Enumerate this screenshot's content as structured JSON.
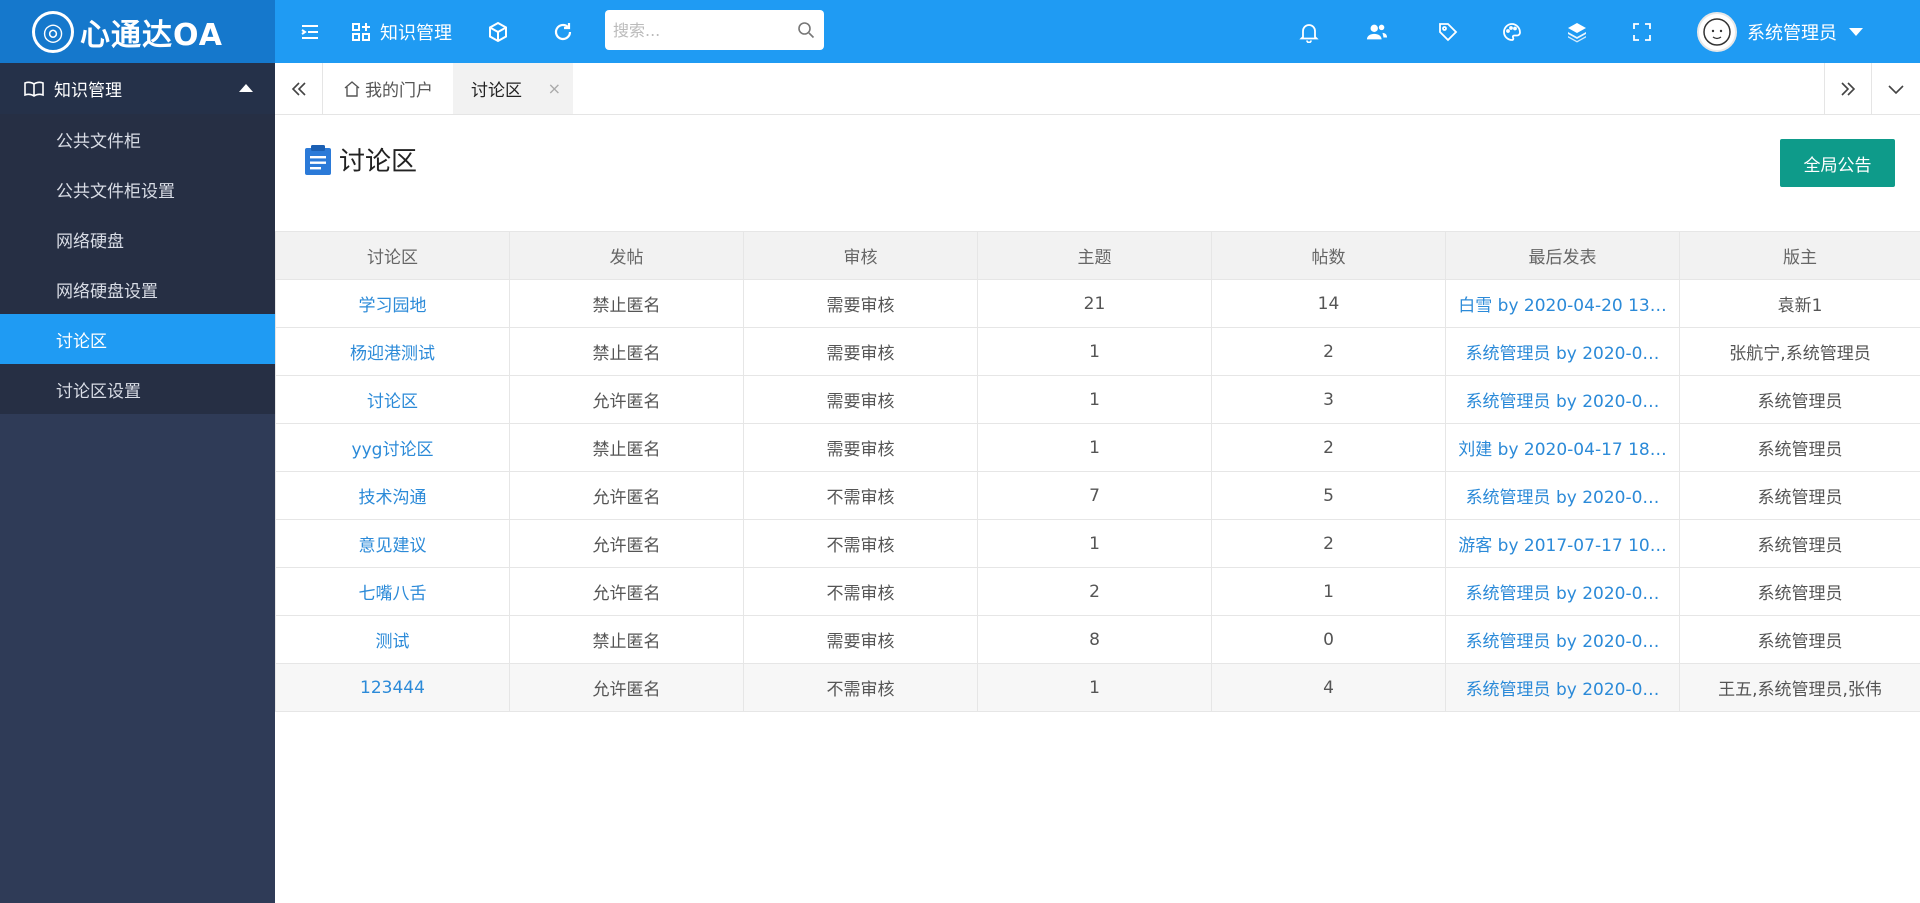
{
  "app": {
    "logo_text": "心通达OA"
  },
  "topbar": {
    "module_label": "知识管理",
    "search_placeholder": "搜索...",
    "user_name": "系统管理员"
  },
  "sidebar": {
    "section_label": "知识管理",
    "items": [
      {
        "label": "公共文件柜",
        "active": false
      },
      {
        "label": "公共文件柜设置",
        "active": false
      },
      {
        "label": "网络硬盘",
        "active": false
      },
      {
        "label": "网络硬盘设置",
        "active": false
      },
      {
        "label": "讨论区",
        "active": true
      },
      {
        "label": "讨论区设置",
        "active": false
      }
    ]
  },
  "tabs": {
    "home_label": "我的门户",
    "active_label": "讨论区",
    "close_glyph": "×"
  },
  "main": {
    "title": "讨论区",
    "notice_button": "全局公告",
    "columns": [
      "讨论区",
      "发帖",
      "审核",
      "主题",
      "帖数",
      "最后发表",
      "版主"
    ],
    "rows": [
      {
        "name": "学习园地",
        "post": "禁止匿名",
        "audit": "需要审核",
        "topics": "21",
        "posts": "14",
        "last": "白雪 by 2020-04-20 13…",
        "mods": "袁新1"
      },
      {
        "name": "杨迎港测试",
        "post": "禁止匿名",
        "audit": "需要审核",
        "topics": "1",
        "posts": "2",
        "last": "系统管理员 by 2020-0…",
        "mods": "张航宁,系统管理员"
      },
      {
        "name": "讨论区",
        "post": "允许匿名",
        "audit": "需要审核",
        "topics": "1",
        "posts": "3",
        "last": "系统管理员 by 2020-0…",
        "mods": "系统管理员"
      },
      {
        "name": "yyg讨论区",
        "post": "禁止匿名",
        "audit": "需要审核",
        "topics": "1",
        "posts": "2",
        "last": "刘建 by 2020-04-17 18…",
        "mods": "系统管理员"
      },
      {
        "name": "技术沟通",
        "post": "允许匿名",
        "audit": "不需审核",
        "topics": "7",
        "posts": "5",
        "last": "系统管理员 by 2020-0…",
        "mods": "系统管理员"
      },
      {
        "name": "意见建议",
        "post": "允许匿名",
        "audit": "不需审核",
        "topics": "1",
        "posts": "2",
        "last": "游客 by 2017-07-17 10…",
        "mods": "系统管理员"
      },
      {
        "name": "七嘴八舌",
        "post": "允许匿名",
        "audit": "不需审核",
        "topics": "2",
        "posts": "1",
        "last": "系统管理员 by 2020-0…",
        "mods": "系统管理员"
      },
      {
        "name": "测试",
        "post": "禁止匿名",
        "audit": "需要审核",
        "topics": "8",
        "posts": "0",
        "last": "系统管理员 by 2020-0…",
        "mods": "系统管理员"
      },
      {
        "name": "123444",
        "post": "允许匿名",
        "audit": "不需审核",
        "topics": "1",
        "posts": "4",
        "last": "系统管理员 by 2020-0…",
        "mods": "王五,系统管理员,张伟"
      }
    ]
  },
  "colors": {
    "topbar": "#1f9bf3",
    "logo_bg": "#1578cc",
    "sidebar": "#2f3b57",
    "active": "#1f9bf3",
    "button": "#0e9b8a",
    "link": "#2b8ad8"
  }
}
